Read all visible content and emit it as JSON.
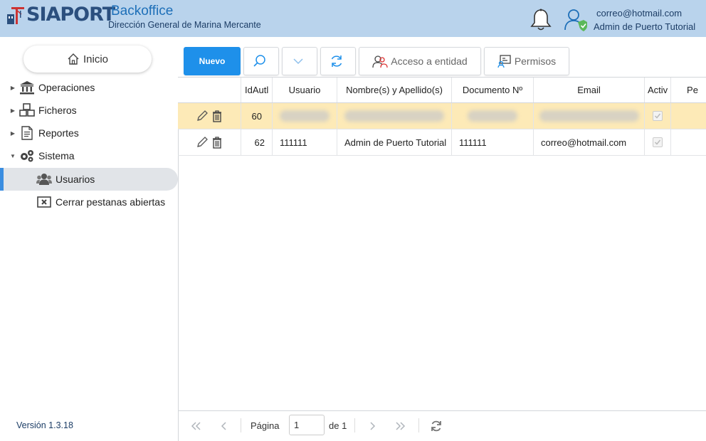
{
  "header": {
    "logo_text": "SIAPORT",
    "app_title": "Backoffice",
    "app_subtitle": "Dirección General de Marina Mercante",
    "user_email": "correo@hotmail.com",
    "user_name": "Admin de Puerto Tutorial"
  },
  "sidebar": {
    "home_label": "Inicio",
    "items": [
      {
        "label": "Operaciones",
        "icon": "bank-icon"
      },
      {
        "label": "Ficheros",
        "icon": "boxes-icon"
      },
      {
        "label": "Reportes",
        "icon": "document-icon"
      },
      {
        "label": "Sistema",
        "icon": "gears-icon"
      }
    ],
    "subitems": [
      {
        "label": "Usuarios",
        "icon": "users-icon",
        "active": true
      },
      {
        "label": "Cerrar pestanas abiertas",
        "icon": "close-tabs-icon",
        "active": false
      }
    ],
    "version": "Versión 1.3.18"
  },
  "toolbar": {
    "new_label": "Nuevo",
    "access_label": "Acceso a entidad",
    "permissions_label": "Permisos"
  },
  "grid": {
    "columns": [
      "",
      "IdAutl",
      "Usuario",
      "Nombre(s) y Apellido(s)",
      "Documento Nº",
      "Email",
      "Activ",
      "Pe"
    ],
    "rows": [
      {
        "id": "60",
        "usuario": "",
        "nombre": "",
        "documento": "",
        "email": "",
        "blurred": true
      },
      {
        "id": "62",
        "usuario": "111111",
        "nombre": "Admin de Puerto Tutorial",
        "documento": "111111",
        "email": "correo@hotmail.com",
        "blurred": false
      }
    ]
  },
  "pager": {
    "page_label": "Página",
    "page_value": "1",
    "of_label": "de 1"
  }
}
